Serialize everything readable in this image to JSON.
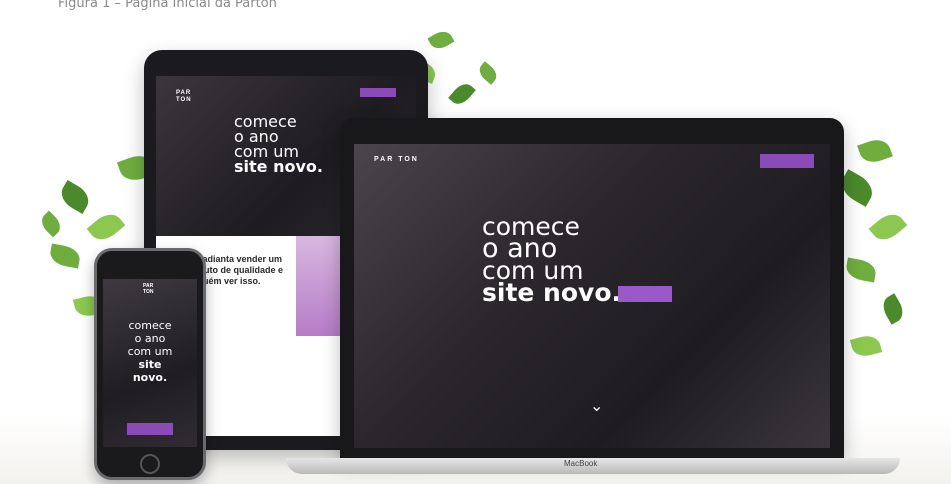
{
  "caption": "Figura 1 – Página Inicial da Parton",
  "laptop": {
    "logo": "PAR TON",
    "headline_line1": "comece",
    "headline_line2": "o ano",
    "headline_line3": "com um",
    "headline_line4": "site novo.",
    "base_label": "MacBook"
  },
  "tablet": {
    "headline_line1": "comece",
    "headline_line2": "o ano",
    "headline_line3": "com um",
    "headline_line4": "site novo.",
    "lower_text": "não adianta vender um produto de qualidade e ninguém ver isso."
  },
  "phone": {
    "logo": "PAR TON",
    "headline_line1": "comece",
    "headline_line2": "o ano",
    "headline_line3": "com um",
    "headline_line4": "site novo."
  },
  "colors": {
    "accent": "#8a4bb8",
    "plant": "#6fae3e"
  }
}
